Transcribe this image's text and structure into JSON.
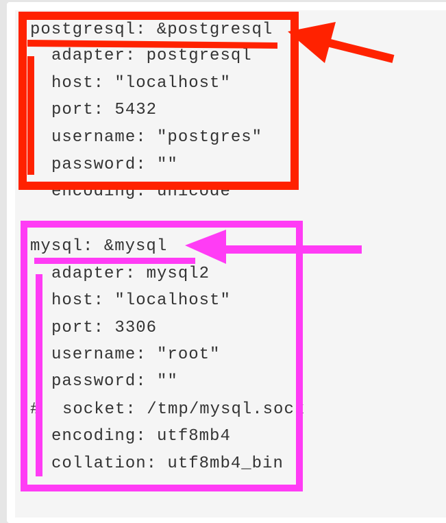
{
  "annotation_colors": {
    "postgresql": "#ff2200",
    "mysql": "#ff3cf5"
  },
  "postgresql_block": {
    "header": "postgresql: &postgresql",
    "lines": [
      "adapter: postgresql",
      "host: \"localhost\"",
      "port: 5432",
      "username: \"postgres\"",
      "password: \"\"",
      "encoding: unicode"
    ]
  },
  "mysql_block": {
    "header": "mysql: &mysql",
    "lines": [
      "adapter: mysql2",
      "host: \"localhost\"",
      "port: 3306",
      "username: \"root\"",
      "password: \"\""
    ],
    "comment_hash": "#",
    "comment_line": "socket: /tmp/mysql.sock",
    "lines_after": [
      "encoding: utf8mb4",
      "collation: utf8mb4_bin"
    ]
  }
}
